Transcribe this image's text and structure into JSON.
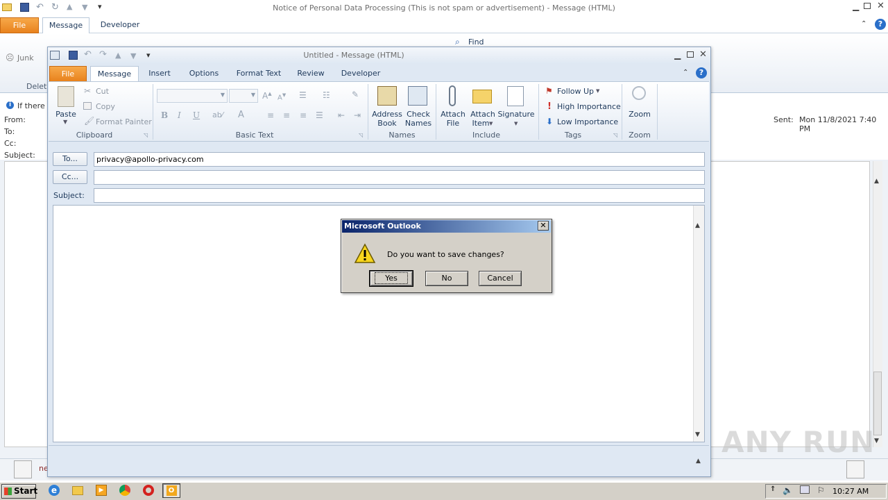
{
  "background_window": {
    "title": "Notice of Personal Data Processing (This is not spam or advertisement)  -  Message (HTML)",
    "tabs": [
      "File",
      "Message",
      "Developer"
    ],
    "ribbon_visible": {
      "junk": "Junk",
      "find": "Find",
      "delete_partial": "Delet"
    },
    "info_bar_partial": "If there",
    "labels": {
      "from": "From:",
      "to": "To:",
      "cc": "Cc:",
      "subject": "Subject:",
      "sent": "Sent:"
    },
    "sent_value": "Mon 11/8/2021 7:40 PM",
    "people_partial": "ne"
  },
  "compose_window": {
    "title": "Untitled  -  Message (HTML)",
    "tabs": [
      "File",
      "Message",
      "Insert",
      "Options",
      "Format Text",
      "Review",
      "Developer"
    ],
    "ribbon": {
      "clipboard": {
        "paste": "Paste",
        "cut": "Cut",
        "copy": "Copy",
        "format_painter": "Format Painter",
        "group": "Clipboard"
      },
      "basic_text": {
        "group": "Basic Text"
      },
      "names": {
        "address_book": [
          "Address",
          "Book"
        ],
        "check_names": [
          "Check",
          "Names"
        ],
        "group": "Names"
      },
      "include": {
        "attach_file": [
          "Attach",
          "File"
        ],
        "attach_item": [
          "Attach",
          "Item"
        ],
        "signature": "Signature",
        "group": "Include"
      },
      "tags": {
        "follow_up": "Follow Up",
        "high_importance": "High Importance",
        "low_importance": "Low Importance",
        "group": "Tags"
      },
      "zoom": {
        "zoom": "Zoom",
        "group": "Zoom"
      }
    },
    "fields": {
      "to_button": "To...",
      "to_value": "privacy@apollo-privacy.com",
      "cc_button": "Cc...",
      "cc_value": "",
      "subject_label": "Subject:",
      "subject_value": ""
    }
  },
  "dialog": {
    "title": "Microsoft Outlook",
    "message": "Do you want to save changes?",
    "buttons": {
      "yes": "Yes",
      "no": "No",
      "cancel": "Cancel"
    }
  },
  "taskbar": {
    "start": "Start",
    "clock": "10:27 AM"
  },
  "watermark": "ANY RUN",
  "colors": {
    "file_tab": "#e8821d",
    "dialog_title_start": "#0a246a",
    "dialog_title_end": "#a6caf0",
    "ribbon_text": "#1e395b"
  }
}
